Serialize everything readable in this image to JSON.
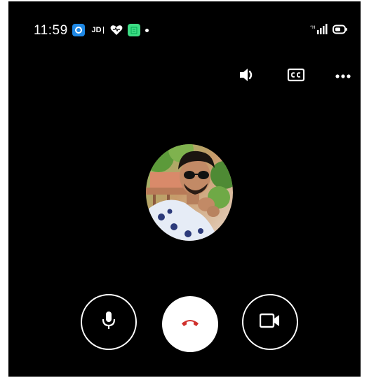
{
  "status_bar": {
    "time": "11:59",
    "notifications": [
      {
        "icon": "app-blue-icon",
        "color": "#1e88e5"
      },
      {
        "icon": "jd-icon",
        "text": "JD"
      },
      {
        "icon": "heart-icon"
      },
      {
        "icon": "calendar-icon",
        "color": "#3ddc84"
      }
    ],
    "system": [
      "signal-icon",
      "battery-icon"
    ]
  },
  "toolbar": {
    "speaker": "speaker-icon",
    "captions": "closed-captions-icon",
    "more": "more-options-icon"
  },
  "contact": {
    "avatar": "contact-avatar"
  },
  "call_controls": {
    "mute": "microphone-icon",
    "end": "end-call-icon",
    "video": "video-camera-icon",
    "end_color": "#d0312d"
  }
}
